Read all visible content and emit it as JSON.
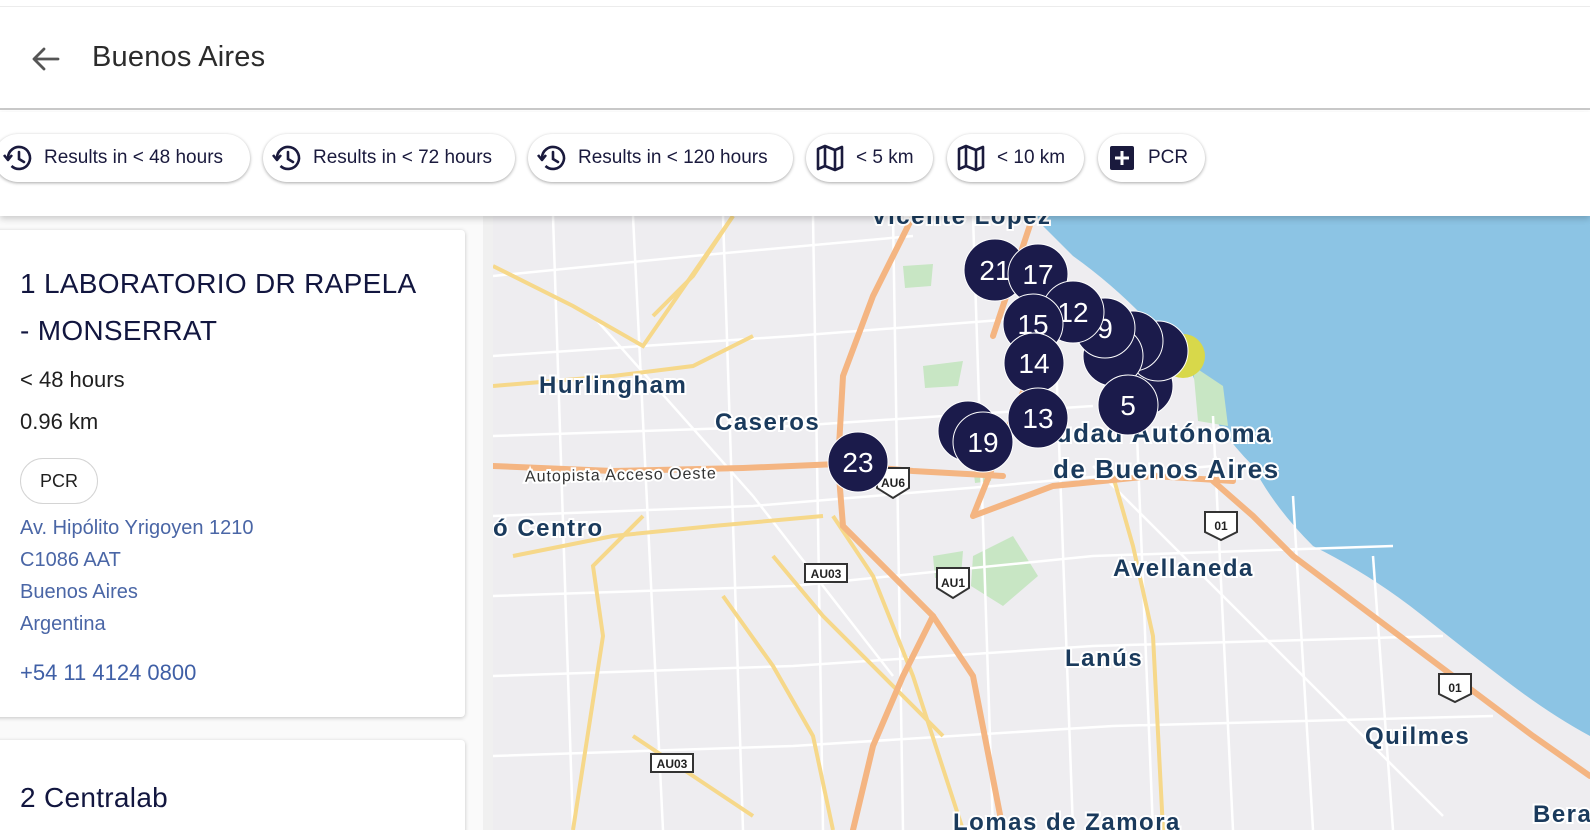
{
  "search": {
    "query": "Buenos Aires"
  },
  "filters": [
    {
      "icon": "history-icon",
      "label": "Results in < 48 hours"
    },
    {
      "icon": "history-icon",
      "label": "Results in < 72 hours"
    },
    {
      "icon": "history-icon",
      "label": "Results in < 120 hours"
    },
    {
      "icon": "map-icon",
      "label": "< 5 km"
    },
    {
      "icon": "map-icon",
      "label": "< 10 km"
    },
    {
      "icon": "plus-box-icon",
      "label": "PCR"
    }
  ],
  "results": [
    {
      "name": "1 LABORATORIO DR RAPELA - MONSERRAT",
      "hours": "< 48 hours",
      "distance": "0.96 km",
      "tag": "PCR",
      "address": [
        "Av. Hipólito Yrigoyen 1210",
        "C1086 AAT",
        "Buenos Aires",
        "Argentina"
      ],
      "phone": "+54 11 4124 0800"
    },
    {
      "name": "2 Centralab"
    }
  ],
  "map": {
    "colors": {
      "water": "#8cc4e4",
      "land": "#eeedf0",
      "park": "#c8e6c4",
      "highway": "#f4b582",
      "arterial": "#f6d88a",
      "street": "#ffffff",
      "marker": "#1b1b4b"
    },
    "labels": [
      "Vicente López",
      "Hurlingham",
      "Caseros",
      "Autopista Acceso Oeste",
      "ó Centro",
      "iudad Autónoma",
      "de Buenos Aires",
      "Avellaneda",
      "Lanús",
      "Quilmes",
      "Lomas de Zamora",
      "Beraza"
    ],
    "shields": [
      "AU6",
      "AU03",
      "AU1",
      "01",
      "01",
      "AU03"
    ],
    "markers": [
      "21",
      "17",
      "12",
      "15",
      "9",
      "14",
      "5",
      "13",
      "19",
      "23"
    ]
  }
}
